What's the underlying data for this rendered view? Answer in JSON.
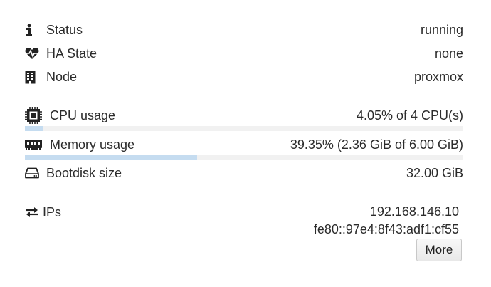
{
  "summary": {
    "status": {
      "label": "Status",
      "value": "running",
      "icon": "info-icon"
    },
    "ha_state": {
      "label": "HA State",
      "value": "none",
      "icon": "heartbeat-icon"
    },
    "node": {
      "label": "Node",
      "value": "proxmox",
      "icon": "building-icon"
    },
    "cpu": {
      "label": "CPU usage",
      "value": "4.05% of 4 CPU(s)",
      "icon": "cpu-chip-icon",
      "usage_percent": 4.05
    },
    "memory": {
      "label": "Memory usage",
      "value": "39.35% (2.36 GiB of 6.00 GiB)",
      "icon": "memory-icon",
      "usage_percent": 39.35
    },
    "bootdisk": {
      "label": "Bootdisk size",
      "value": "32.00 GiB",
      "icon": "hdd-icon"
    },
    "ips": {
      "label": "IPs",
      "icon": "exchange-arrows-icon",
      "addresses": [
        "192.168.146.10",
        "fe80::97e4:8f43:adf1:cf55"
      ],
      "more_label": "More"
    }
  },
  "colors": {
    "bar_track": "#f1f1f1",
    "bar_fill": "#c5dcf0",
    "text": "#2b2b2b"
  }
}
